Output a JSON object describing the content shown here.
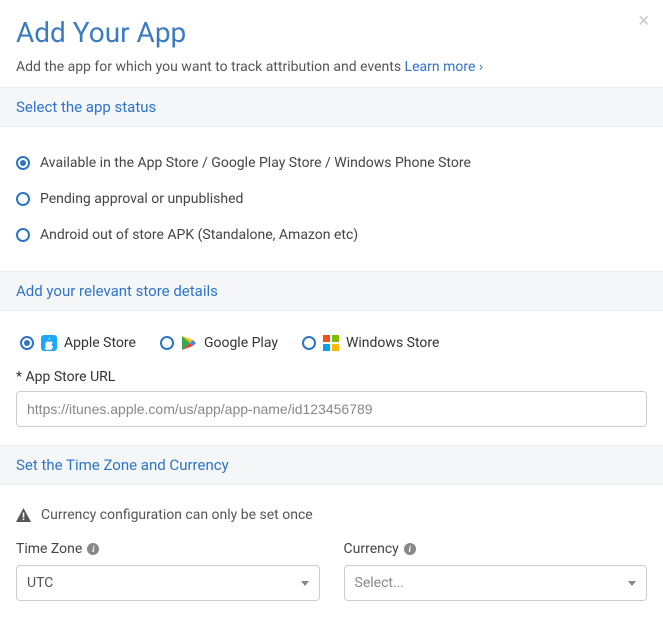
{
  "modal": {
    "title": "Add Your App",
    "subtitle_text": "Add the app for which you want to track attribution and events ",
    "learn_more": "Learn more ›"
  },
  "status_section": {
    "header": "Select the app status",
    "options": [
      {
        "label": "Available in the App Store / Google Play Store / Windows Phone Store",
        "selected": true
      },
      {
        "label": "Pending approval or unpublished",
        "selected": false
      },
      {
        "label": "Android out of store APK (Standalone, Amazon etc)",
        "selected": false
      }
    ]
  },
  "store_section": {
    "header": "Add your relevant store details",
    "stores": [
      {
        "label": "Apple Store",
        "selected": true,
        "icon": "apple-store-icon"
      },
      {
        "label": "Google Play",
        "selected": false,
        "icon": "google-play-icon"
      },
      {
        "label": "Windows Store",
        "selected": false,
        "icon": "windows-store-icon"
      }
    ],
    "url_field_label": "* App Store URL",
    "url_placeholder": "https://itunes.apple.com/us/app/app-name/id123456789"
  },
  "tz_section": {
    "header": "Set the Time Zone and Currency",
    "warning": "Currency configuration can only be set once",
    "timezone_label": "Time Zone",
    "timezone_value": "UTC",
    "currency_label": "Currency",
    "currency_value": "Select..."
  }
}
